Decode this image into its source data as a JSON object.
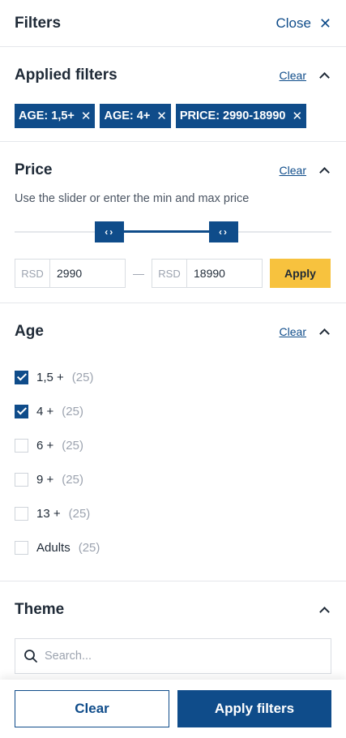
{
  "header": {
    "title": "Filters",
    "close_label": "Close",
    "close_icon": "close-icon"
  },
  "applied": {
    "title": "Applied filters",
    "clear_label": "Clear",
    "chips": [
      "AGE: 1,5+",
      "AGE: 4+",
      "PRICE: 2990-18990"
    ]
  },
  "price": {
    "title": "Price",
    "clear_label": "Clear",
    "hint": "Use the slider or enter the min and max price",
    "currency": "RSD",
    "min_value": "2990",
    "max_value": "18990",
    "slider_min_fraction": 0.3,
    "slider_max_fraction": 0.66,
    "apply_label": "Apply"
  },
  "age": {
    "title": "Age",
    "clear_label": "Clear",
    "options": [
      {
        "label": "1,5 +",
        "count": "(25)",
        "checked": true
      },
      {
        "label": "4 +",
        "count": "(25)",
        "checked": true
      },
      {
        "label": "6 +",
        "count": "(25)",
        "checked": false
      },
      {
        "label": "9 +",
        "count": "(25)",
        "checked": false
      },
      {
        "label": "13 +",
        "count": "(25)",
        "checked": false
      },
      {
        "label": "Adults",
        "count": "(25)",
        "checked": false
      }
    ]
  },
  "theme": {
    "title": "Theme",
    "search_placeholder": "Search..."
  },
  "footer": {
    "clear_label": "Clear",
    "apply_label": "Apply filters"
  },
  "colors": {
    "primary": "#0f4c8a",
    "accent": "#f7c23e",
    "muted": "#9ca3af"
  }
}
